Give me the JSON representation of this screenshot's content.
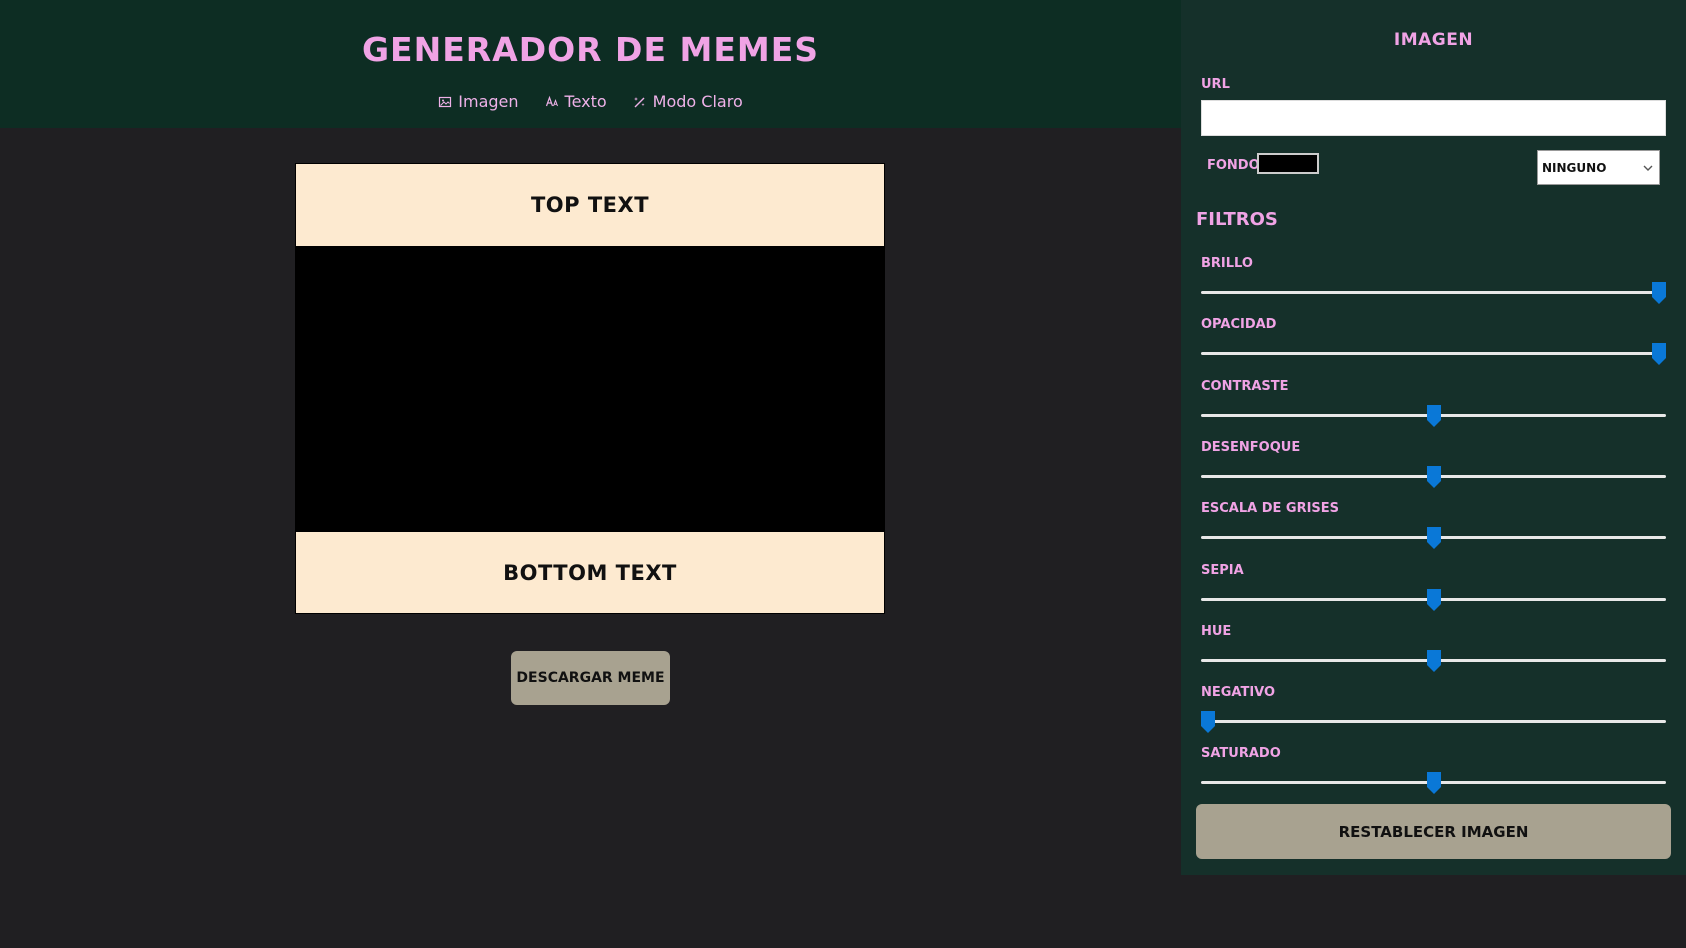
{
  "header": {
    "title": "Generador de Memes",
    "nav": [
      {
        "label": "Imagen",
        "icon": "image-icon"
      },
      {
        "label": "Texto",
        "icon": "text-icon"
      },
      {
        "label": "Modo Claro",
        "icon": "magic-wand-icon"
      }
    ]
  },
  "meme": {
    "top_text": "Top Text",
    "bottom_text": "Bottom Text",
    "background_color": "#000000",
    "text_background_color": "#fdead0"
  },
  "download_label": "Descargar meme",
  "panel": {
    "title": "Imagen",
    "url_label": "URL",
    "url_value": "",
    "fondo_label": "Fondo",
    "fondo_color": "#000000",
    "blend_mode": "Ninguno",
    "filters_title": "Filtros",
    "filters": [
      {
        "label": "Brillo",
        "value": 1.0
      },
      {
        "label": "Opacidad",
        "value": 1.0
      },
      {
        "label": "Contraste",
        "value": 0.5
      },
      {
        "label": "Desenfoque",
        "value": 0.5
      },
      {
        "label": "Escala de grises",
        "value": 0.5
      },
      {
        "label": "Sepia",
        "value": 0.5
      },
      {
        "label": "Hue",
        "value": 0.5
      },
      {
        "label": "Negativo",
        "value": 0.0
      },
      {
        "label": "Saturado",
        "value": 0.5
      }
    ],
    "reset_label": "Restablecer imagen"
  },
  "colors": {
    "header_bg": "#0d2d23",
    "panel_bg": "#15302a",
    "page_bg": "#201f22",
    "accent_pink": "#f0a3e5",
    "button_bg": "#a8a290",
    "slider_thumb": "#0a78d7"
  }
}
